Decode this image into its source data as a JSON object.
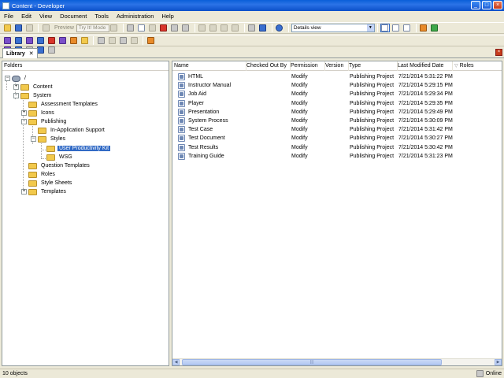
{
  "window": {
    "title": "Content - Developer"
  },
  "menu": [
    "File",
    "Edit",
    "View",
    "Document",
    "Tools",
    "Administration",
    "Help"
  ],
  "toolbar": {
    "preview_label": "Preview",
    "mode_value": "Try It! Mode",
    "view_select": "Details view"
  },
  "tab": {
    "label": "Library"
  },
  "left_panel": {
    "header": "Folders",
    "tree": [
      {
        "label": "/"
      },
      {
        "label": "Content"
      },
      {
        "label": "System"
      },
      {
        "label": "Assessment Templates"
      },
      {
        "label": "Icons"
      },
      {
        "label": "Publishing"
      },
      {
        "label": "In-Application Support"
      },
      {
        "label": "Styles"
      },
      {
        "label": "User Productivity Kit"
      },
      {
        "label": "WSG"
      },
      {
        "label": "Question Templates"
      },
      {
        "label": "Roles"
      },
      {
        "label": "Style Sheets"
      },
      {
        "label": "Templates"
      }
    ]
  },
  "list": {
    "columns": [
      "Name",
      "Checked Out By",
      "Permission",
      "Version",
      "Type",
      "Last Modified Date",
      "Roles"
    ],
    "rows": [
      {
        "name": "HTML",
        "checked_out_by": "",
        "permission": "Modify",
        "version": "",
        "type": "Publishing Project",
        "modified": "7/21/2014 5:31:22 PM"
      },
      {
        "name": "Instructor Manual",
        "checked_out_by": "",
        "permission": "Modify",
        "version": "",
        "type": "Publishing Project",
        "modified": "7/21/2014 5:29:15 PM"
      },
      {
        "name": "Job Aid",
        "checked_out_by": "",
        "permission": "Modify",
        "version": "",
        "type": "Publishing Project",
        "modified": "7/21/2014 5:29:34 PM"
      },
      {
        "name": "Player",
        "checked_out_by": "",
        "permission": "Modify",
        "version": "",
        "type": "Publishing Project",
        "modified": "7/21/2014 5:29:35 PM"
      },
      {
        "name": "Presentation",
        "checked_out_by": "",
        "permission": "Modify",
        "version": "",
        "type": "Publishing Project",
        "modified": "7/21/2014 5:29:49 PM"
      },
      {
        "name": "System Process",
        "checked_out_by": "",
        "permission": "Modify",
        "version": "",
        "type": "Publishing Project",
        "modified": "7/21/2014 5:30:09 PM"
      },
      {
        "name": "Test Case",
        "checked_out_by": "",
        "permission": "Modify",
        "version": "",
        "type": "Publishing Project",
        "modified": "7/21/2014 5:31:42 PM"
      },
      {
        "name": "Test Document",
        "checked_out_by": "",
        "permission": "Modify",
        "version": "",
        "type": "Publishing Project",
        "modified": "7/21/2014 5:30:27 PM"
      },
      {
        "name": "Test Results",
        "checked_out_by": "",
        "permission": "Modify",
        "version": "",
        "type": "Publishing Project",
        "modified": "7/21/2014 5:30:42 PM"
      },
      {
        "name": "Training Guide",
        "checked_out_by": "",
        "permission": "Modify",
        "version": "",
        "type": "Publishing Project",
        "modified": "7/21/2014 5:31:23 PM"
      }
    ]
  },
  "status": {
    "count": "10 objects",
    "connection": "Online"
  },
  "colors": {
    "selection": "#316AC5",
    "titlebar": "#0A5FD9",
    "chrome": "#ECE9D8"
  }
}
